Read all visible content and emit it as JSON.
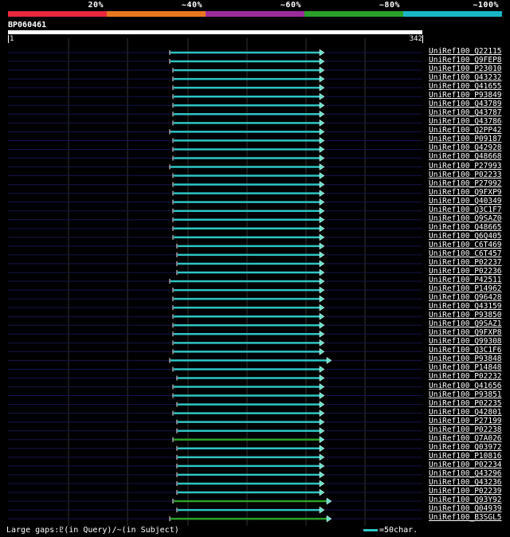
{
  "legend": {
    "labels": [
      "20%",
      "~40%",
      "~60%",
      "~80%",
      "~100%"
    ],
    "colors": [
      "#e8283c",
      "#e87820",
      "#9b2d9b",
      "#2aa02a",
      "#1ab6c6"
    ]
  },
  "query": {
    "id": "BP060461",
    "start": "1",
    "end": "342"
  },
  "hits": [
    {
      "label": "UniRef100_Q22115",
      "start": 213,
      "end": 405,
      "color": "#2ec4c4"
    },
    {
      "label": "UniRef100_Q9FEP8",
      "start": 213,
      "end": 405,
      "color": "#2ec4c4"
    },
    {
      "label": "UniRef100_P23010",
      "start": 217,
      "end": 405,
      "color": "#2ec4c4"
    },
    {
      "label": "UniRef100_Q43232",
      "start": 217,
      "end": 405,
      "color": "#2ec4c4"
    },
    {
      "label": "UniRef100_Q41655",
      "start": 217,
      "end": 405,
      "color": "#2ec4c4"
    },
    {
      "label": "UniRef100_P93849",
      "start": 217,
      "end": 405,
      "color": "#2ec4c4"
    },
    {
      "label": "UniRef100_Q43789",
      "start": 217,
      "end": 405,
      "color": "#2ec4c4"
    },
    {
      "label": "UniRef100_Q43787",
      "start": 217,
      "end": 405,
      "color": "#2ec4c4"
    },
    {
      "label": "UniRef100_Q43786",
      "start": 217,
      "end": 405,
      "color": "#2ec4c4"
    },
    {
      "label": "UniRef100_Q2PP42",
      "start": 213,
      "end": 405,
      "color": "#2ec4c4"
    },
    {
      "label": "UniRef100_P09187",
      "start": 217,
      "end": 405,
      "color": "#2ec4c4"
    },
    {
      "label": "UniRef100_Q42928",
      "start": 217,
      "end": 405,
      "color": "#2ec4c4"
    },
    {
      "label": "UniRef100_Q48668",
      "start": 217,
      "end": 405,
      "color": "#2ec4c4"
    },
    {
      "label": "UniRef100_P27993",
      "start": 213,
      "end": 405,
      "color": "#2ec4c4"
    },
    {
      "label": "UniRef100_P02233",
      "start": 217,
      "end": 405,
      "color": "#2ec4c4"
    },
    {
      "label": "UniRef100_P27992",
      "start": 217,
      "end": 405,
      "color": "#2ec4c4"
    },
    {
      "label": "UniRef100_Q9FXP9",
      "start": 217,
      "end": 405,
      "color": "#2ec4c4"
    },
    {
      "label": "UniRef100_Q40349",
      "start": 217,
      "end": 405,
      "color": "#2ec4c4"
    },
    {
      "label": "UniRef100_Q3C1F7",
      "start": 217,
      "end": 405,
      "color": "#2ec4c4"
    },
    {
      "label": "UniRef100_Q9SAZ0",
      "start": 217,
      "end": 405,
      "color": "#2ec4c4"
    },
    {
      "label": "UniRef100_Q48665",
      "start": 217,
      "end": 405,
      "color": "#2ec4c4"
    },
    {
      "label": "UniRef100_Q6Q405",
      "start": 217,
      "end": 405,
      "color": "#2ec4c4"
    },
    {
      "label": "UniRef100_C6T469",
      "start": 222,
      "end": 405,
      "color": "#2ec4c4"
    },
    {
      "label": "UniRef100_C6T457",
      "start": 222,
      "end": 405,
      "color": "#2ec4c4"
    },
    {
      "label": "UniRef100_P02237",
      "start": 222,
      "end": 405,
      "color": "#2ec4c4"
    },
    {
      "label": "UniRef100_P02236",
      "start": 222,
      "end": 405,
      "color": "#2ec4c4"
    },
    {
      "label": "UniRef100_P42511",
      "start": 213,
      "end": 405,
      "color": "#2ec4c4"
    },
    {
      "label": "UniRef100_P14962",
      "start": 217,
      "end": 405,
      "color": "#2ec4c4"
    },
    {
      "label": "UniRef100_Q96428",
      "start": 217,
      "end": 405,
      "color": "#2ec4c4"
    },
    {
      "label": "UniRef100_Q43159",
      "start": 217,
      "end": 405,
      "color": "#2ec4c4"
    },
    {
      "label": "UniRef100_P93850",
      "start": 217,
      "end": 405,
      "color": "#2ec4c4"
    },
    {
      "label": "UniRef100_Q9SAZ1",
      "start": 217,
      "end": 405,
      "color": "#2ec4c4"
    },
    {
      "label": "UniRef100_Q9FXP8",
      "start": 217,
      "end": 405,
      "color": "#2ec4c4"
    },
    {
      "label": "UniRef100_Q99308",
      "start": 217,
      "end": 405,
      "color": "#2ec4c4"
    },
    {
      "label": "UniRef100_Q3C1F6",
      "start": 217,
      "end": 405,
      "color": "#2ec4c4"
    },
    {
      "label": "UniRef100_P93848",
      "start": 213,
      "end": 414,
      "color": "#2ec4c4"
    },
    {
      "label": "UniRef100_P14848",
      "start": 217,
      "end": 405,
      "color": "#2ec4c4"
    },
    {
      "label": "UniRef100_P02232",
      "start": 222,
      "end": 405,
      "color": "#2ec4c4"
    },
    {
      "label": "UniRef100_Q41656",
      "start": 217,
      "end": 405,
      "color": "#2ec4c4"
    },
    {
      "label": "UniRef100_P93851",
      "start": 217,
      "end": 405,
      "color": "#2ec4c4"
    },
    {
      "label": "UniRef100_P02235",
      "start": 222,
      "end": 405,
      "color": "#2ec4c4"
    },
    {
      "label": "UniRef100_Q42801",
      "start": 217,
      "end": 405,
      "color": "#2ec4c4"
    },
    {
      "label": "UniRef100_P27199",
      "start": 222,
      "end": 405,
      "color": "#2ec4c4"
    },
    {
      "label": "UniRef100_P02238",
      "start": 222,
      "end": 405,
      "color": "#2ec4c4"
    },
    {
      "label": "UniRef100_Q7A026",
      "start": 217,
      "end": 405,
      "color": "#2aa02a"
    },
    {
      "label": "UniRef100_Q03972",
      "start": 222,
      "end": 405,
      "color": "#2ec4c4"
    },
    {
      "label": "UniRef100_P10816",
      "start": 222,
      "end": 405,
      "color": "#2ec4c4"
    },
    {
      "label": "UniRef100_P02234",
      "start": 222,
      "end": 405,
      "color": "#2ec4c4"
    },
    {
      "label": "UniRef100_Q43296",
      "start": 222,
      "end": 405,
      "color": "#2ec4c4"
    },
    {
      "label": "UniRef100_Q43236",
      "start": 222,
      "end": 405,
      "color": "#2ec4c4"
    },
    {
      "label": "UniRef100_P02239",
      "start": 222,
      "end": 405,
      "color": "#2ec4c4"
    },
    {
      "label": "UniRef100_Q93Y92",
      "start": 217,
      "end": 414,
      "color": "#2aa02a"
    },
    {
      "label": "UniRef100_Q04939",
      "start": 222,
      "end": 405,
      "color": "#2ec4c4"
    },
    {
      "label": "UniRef100_B3SGL5",
      "start": 213,
      "end": 414,
      "color": "#2aa02a"
    }
  ],
  "footer": {
    "gaps_text": "Large gaps:♇(in Query)/~(in Subject)",
    "scale_text": "=50char."
  }
}
